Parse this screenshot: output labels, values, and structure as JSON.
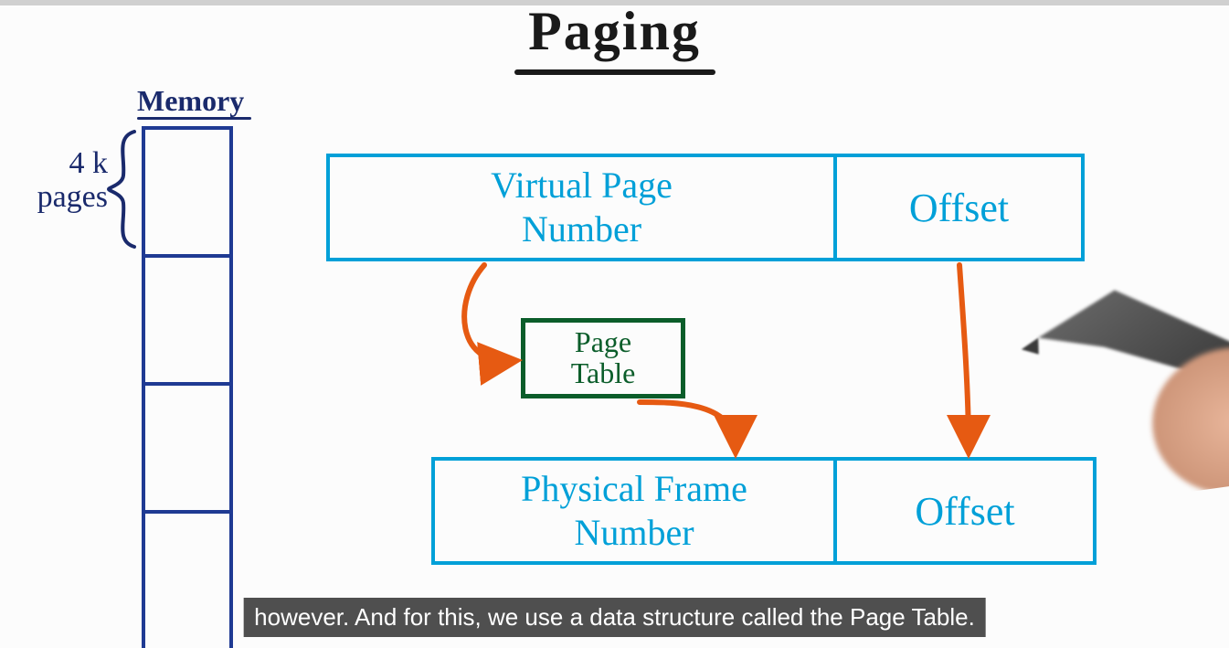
{
  "title": "Paging",
  "memory": {
    "label": "Memory",
    "page_size_label": "4 k\npages"
  },
  "virtual_address": {
    "page_part": "Virtual Page\nNumber",
    "offset_part": "Offset"
  },
  "page_table": {
    "label": "Page\nTable"
  },
  "physical_address": {
    "frame_part": "Physical Frame\nNumber",
    "offset_part": "Offset"
  },
  "caption": "however. And for this, we use a data structure called the Page Table.",
  "colors": {
    "title": "#1a1a1a",
    "memory_ink": "#1f3a93",
    "box_ink": "#00a0d8",
    "page_table_ink": "#0b5d2a",
    "arrow_ink": "#e65a12"
  }
}
